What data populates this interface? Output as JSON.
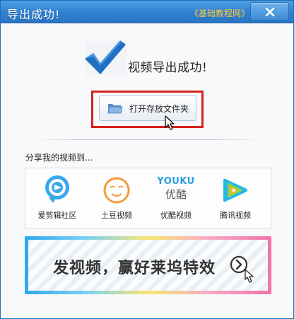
{
  "window": {
    "title": "导出成功!",
    "watermark": "《基础教程网》"
  },
  "main": {
    "success_message": "视频导出成功!",
    "open_folder_label": "打开存放文件夹"
  },
  "share": {
    "title": "分享我的视频到...",
    "items": [
      {
        "label": "爱剪辑社区",
        "icon": "aijianji-community-icon"
      },
      {
        "label": "土豆视频",
        "icon": "tudou-icon"
      },
      {
        "label": "优酷视频",
        "icon": "youku-icon",
        "logo_text": "YOUKU",
        "logo_sub": "优酷"
      },
      {
        "label": "腾讯视频",
        "icon": "tencent-video-icon"
      }
    ]
  },
  "banner": {
    "text": "发视频，赢好莱坞特效"
  },
  "colors": {
    "titlebar": "#2f7fd0",
    "accent_red": "#d6221e",
    "check_blue": "#1f6fc2"
  }
}
